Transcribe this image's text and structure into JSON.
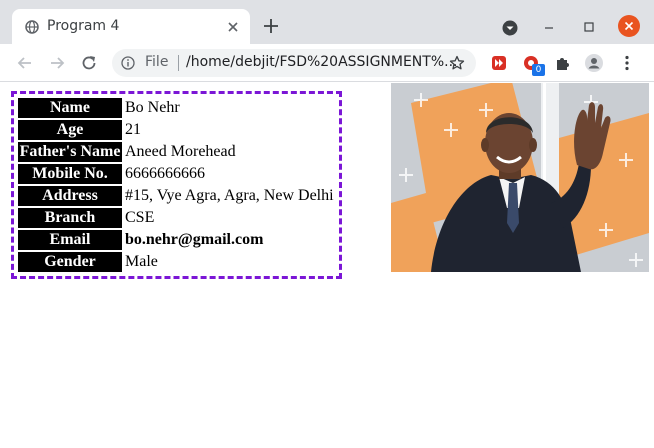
{
  "browser": {
    "tab_title": "Program 4",
    "omnibox_scheme": "File",
    "url": "/home/debjit/FSD%20ASSIGNMENT%...",
    "extension_badge": "0"
  },
  "icons": [
    "globe-icon",
    "close-icon",
    "plus-icon",
    "tab-search-icon",
    "minimize-icon",
    "maximize-icon",
    "window-close-icon",
    "back-icon",
    "forward-icon",
    "reload-icon",
    "info-icon",
    "star-icon",
    "extension-icon",
    "puzzle-icon",
    "profile-icon",
    "menu-icon"
  ],
  "colors": {
    "table_border": "#7b16d6",
    "label_bg": "#000000",
    "label_fg": "#ffffff",
    "window_close": "#e95420"
  },
  "table": {
    "rows": [
      {
        "label": "Name",
        "value": "Bo Nehr",
        "bold": false
      },
      {
        "label": "Age",
        "value": "21",
        "bold": false
      },
      {
        "label": "Father's Name",
        "value": "Aneed Morehead",
        "bold": false
      },
      {
        "label": "Mobile No.",
        "value": "6666666666",
        "bold": false
      },
      {
        "label": "Address",
        "value": "#15, Vye Agra, Agra, New Delhi",
        "bold": false
      },
      {
        "label": "Branch",
        "value": "CSE",
        "bold": false
      },
      {
        "label": "Email",
        "value": "bo.nehr@gmail.com",
        "bold": true
      },
      {
        "label": "Gender",
        "value": "Male",
        "bold": false
      }
    ]
  }
}
